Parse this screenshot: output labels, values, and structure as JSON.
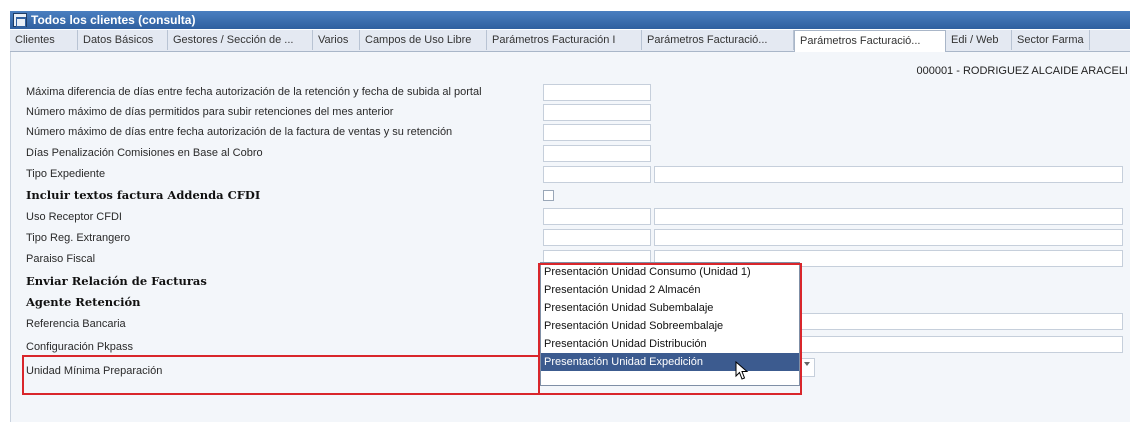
{
  "window": {
    "title": "Todos los clientes (consulta)"
  },
  "tabs": [
    "Clientes",
    "Datos Básicos",
    "Gestores / Sección de ...",
    "Varios",
    "Campos de Uso Libre",
    "Parámetros Facturación I",
    "Parámetros Facturació...",
    "Parámetros Facturació...",
    "Edi / Web",
    "Sector Farma"
  ],
  "active_tab_index": 7,
  "client": "000001 - RODRIGUEZ ALCAIDE ARACELI",
  "fields": {
    "max_dif_dias": "Máxima diferencia de días entre fecha autorización de la retención y fecha de subida al portal",
    "num_max_dias_subir": "Número máximo de días permitidos para subir retenciones del mes anterior",
    "num_max_dias_factura": "Número máximo de días entre fecha autorización de la factura de ventas y su retención",
    "dias_penalizacion": "Días Penalización Comisiones en Base al Cobro",
    "tipo_expediente": "Tipo Expediente",
    "incluir_textos": "Incluir textos factura Addenda CFDI",
    "uso_receptor": "Uso Receptor CFDI",
    "tipo_reg": "Tipo Reg. Extrangero",
    "paraiso_fiscal": "Paraiso Fiscal",
    "enviar_relacion": "Enviar Relación de Facturas",
    "agente_retencion": "Agente Retención",
    "referencia_bancaria": "Referencia Bancaria",
    "configuracion_pkpass": "Configuración Pkpass",
    "unidad_minima": "Unidad Mínima Preparación"
  },
  "dropdown": {
    "options": [
      "Presentación Unidad Consumo (Unidad 1)",
      "Presentación Unidad 2 Almacén",
      "Presentación Unidad Subembalaje",
      "Presentación Unidad Sobreembalaje",
      "Presentación Unidad Distribución",
      "Presentación Unidad Expedición"
    ],
    "selected_index": 5
  },
  "icons": {
    "window": "app-window-icon",
    "dropdown_arrow": "chevron-down-icon",
    "cursor": "mouse-pointer-icon"
  },
  "colors": {
    "title_bar": "#2f5f9f",
    "highlight": "#d9262b",
    "selected_option": "#3c5b8f"
  }
}
